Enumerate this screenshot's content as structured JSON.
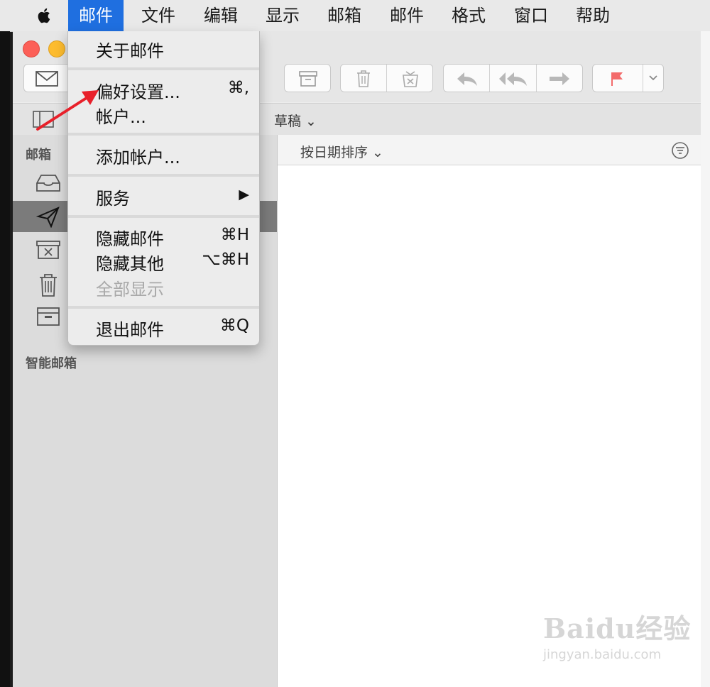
{
  "menubar": {
    "items": [
      {
        "label": "邮件",
        "active": true
      },
      {
        "label": "文件"
      },
      {
        "label": "编辑"
      },
      {
        "label": "显示"
      },
      {
        "label": "邮箱"
      },
      {
        "label": "邮件"
      },
      {
        "label": "格式"
      },
      {
        "label": "窗口"
      },
      {
        "label": "帮助"
      }
    ]
  },
  "dropdown": {
    "about": "关于邮件",
    "preferences": "偏好设置...",
    "preferences_shortcut": "⌘,",
    "accounts": "帐户...",
    "add_account": "添加帐户...",
    "services": "服务",
    "services_arrow": "▶",
    "hide_mail": "隐藏邮件",
    "hide_mail_shortcut": "⌘H",
    "hide_others": "隐藏其他",
    "hide_others_shortcut": "⌥⌘H",
    "show_all": "全部显示",
    "quit": "退出邮件",
    "quit_shortcut": "⌘Q"
  },
  "favorites_bar": {
    "drafts_label": "草稿 ⌄"
  },
  "sidebar": {
    "mailboxes_header": "邮箱",
    "smart_mailboxes_header": "智能邮箱"
  },
  "message_list": {
    "sort_label": "按日期排序 ⌄"
  },
  "watermark": {
    "brand": "Baidu经验",
    "url": "jingyan.baidu.com"
  },
  "colors": {
    "menu_highlight": "#1f6fe0",
    "flag": "#f36b6b",
    "arrow": "#e8202a"
  }
}
